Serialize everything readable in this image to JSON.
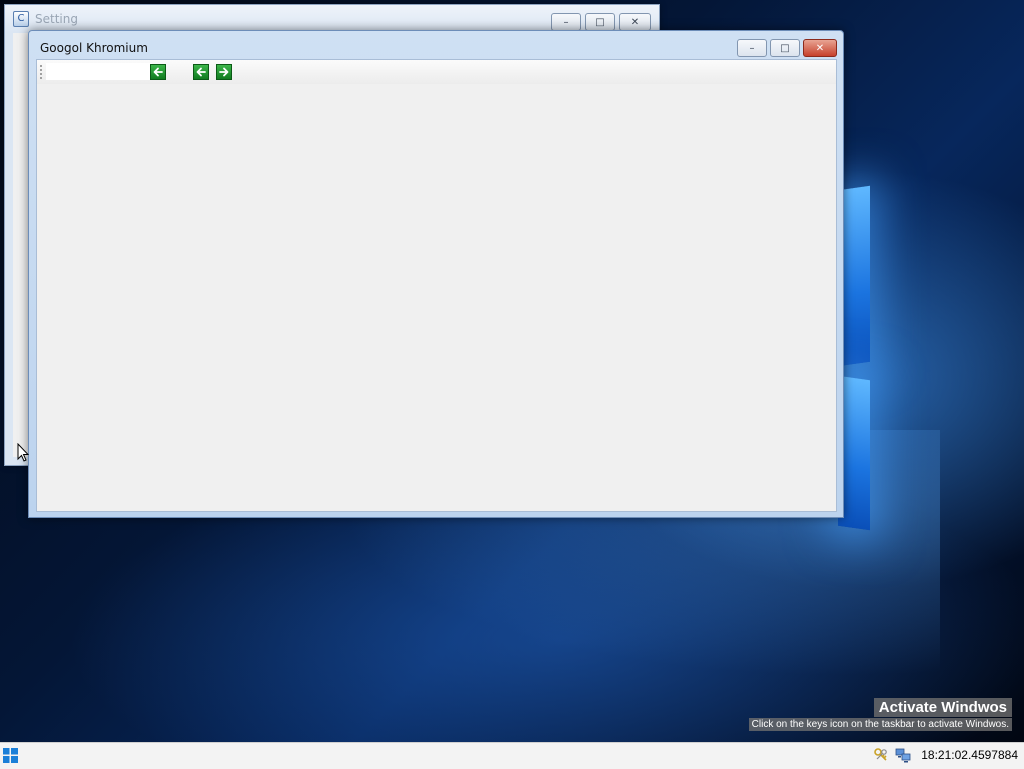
{
  "background_window": {
    "title": "Setting",
    "buttons": {
      "minimize": "–",
      "maximize": "□",
      "close": "✕"
    }
  },
  "main_window": {
    "title": "Googol Khromium",
    "buttons": {
      "minimize": "–",
      "maximize": "□",
      "close": "✕"
    },
    "toolbar": {
      "address_value": "",
      "address_placeholder": "",
      "go_icon": "arrow-left-icon",
      "back_icon": "arrow-left-icon",
      "forward_icon": "arrow-right-icon",
      "button_color": "#1e9a2e"
    }
  },
  "watermark": {
    "title": "Activate Windwos",
    "subtitle": "Click on the keys icon on the taskbar to activate Windwos."
  },
  "taskbar": {
    "start_icon": "windows-logo-icon",
    "tray_icons": [
      "keys-icon",
      "network-icon"
    ],
    "clock": "18:21:02.4597884"
  },
  "colors": {
    "desktop_accent": "#1b74e0",
    "window_frame": "#bcd3ee",
    "close_button": "#c7412c",
    "client_bg": "#f0f0f0"
  }
}
